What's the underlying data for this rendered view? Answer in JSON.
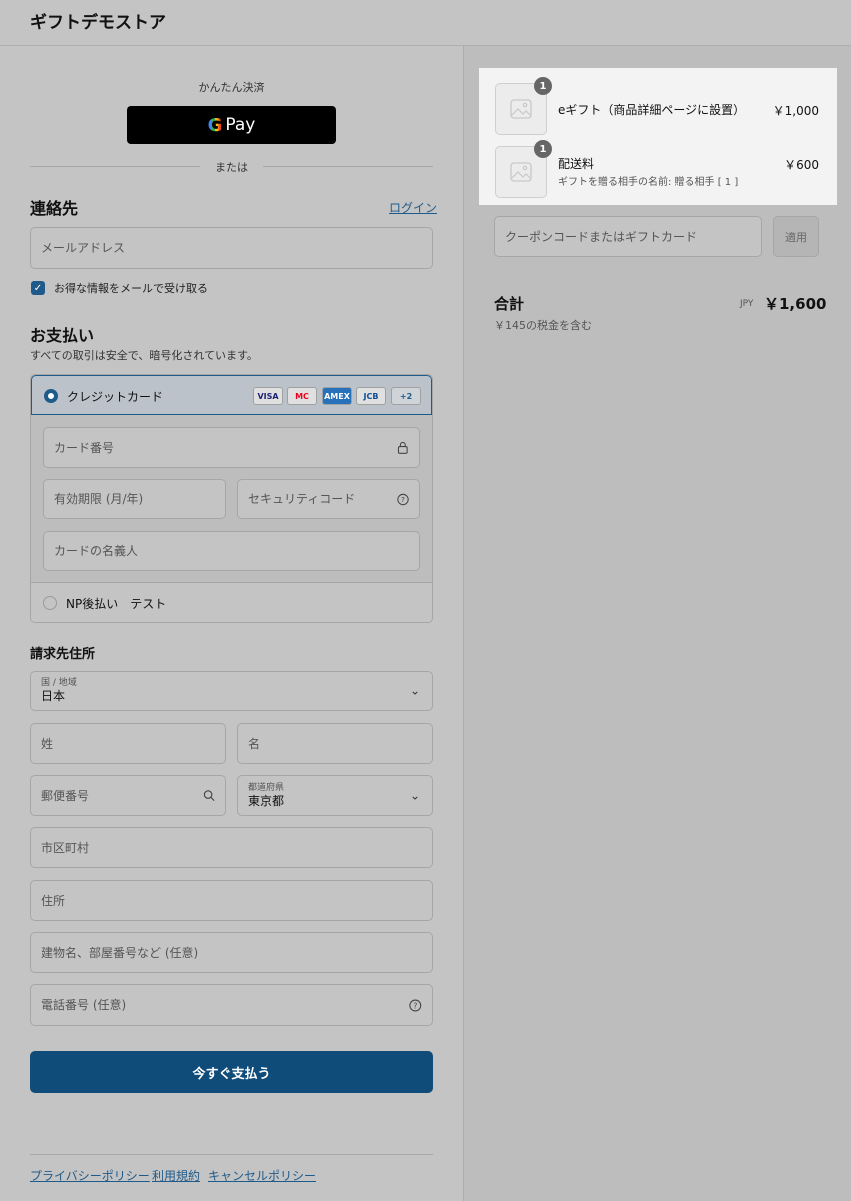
{
  "header": {
    "store_name": "ギフトデモストア"
  },
  "express": {
    "label": "かんたん決済",
    "gpay_g": "G",
    "gpay_text": "Pay",
    "or_label": "または"
  },
  "contact": {
    "title": "連絡先",
    "login": "ログイン",
    "email_placeholder": "メールアドレス",
    "newsletter_label": "お得な情報をメールで受け取る",
    "newsletter_checked": true
  },
  "payment": {
    "title": "お支払い",
    "subtitle": "すべての取引は安全で、暗号化されています。",
    "credit_label": "クレジットカード",
    "card_logos": [
      "VISA",
      "MC",
      "AMEX",
      "JCB"
    ],
    "more_cards": "+2",
    "card_number_placeholder": "カード番号",
    "expiry_placeholder": "有効期限 (月/年)",
    "security_placeholder": "セキュリティコード",
    "name_placeholder": "カードの名義人",
    "np_label": "NP後払い　テスト"
  },
  "billing": {
    "title": "請求先住所",
    "country_caption": "国 / 地域",
    "country_value": "日本",
    "last_name_placeholder": "姓",
    "first_name_placeholder": "名",
    "postal_placeholder": "郵便番号",
    "prefecture_caption": "都道府県",
    "prefecture_value": "東京都",
    "city_placeholder": "市区町村",
    "address_placeholder": "住所",
    "building_placeholder": "建物名、部屋番号など (任意)",
    "phone_placeholder": "電話番号 (任意)"
  },
  "pay_now_label": "今すぐ支払う",
  "footer": {
    "privacy": "プライバシーポリシー",
    "terms": "利用規約",
    "cancel": "キャンセルポリシー"
  },
  "order": {
    "items": [
      {
        "qty": "1",
        "name": "eギフト（商品詳細ページに設置）",
        "sub": "",
        "price": "￥1,000"
      },
      {
        "qty": "1",
        "name": "配送料",
        "sub": "ギフトを贈る相手の名前: 贈る相手 [ 1 ]",
        "price": "￥600"
      }
    ],
    "coupon_placeholder": "クーポンコードまたはギフトカード",
    "apply_label": "適用",
    "total_label": "合計",
    "total_currency": "JPY",
    "total_value": "￥1,600",
    "tax_note": "￥145の税金を含む"
  },
  "colors": {
    "accent": "#1f5b8a",
    "pay_button": "#0f4c7a"
  }
}
